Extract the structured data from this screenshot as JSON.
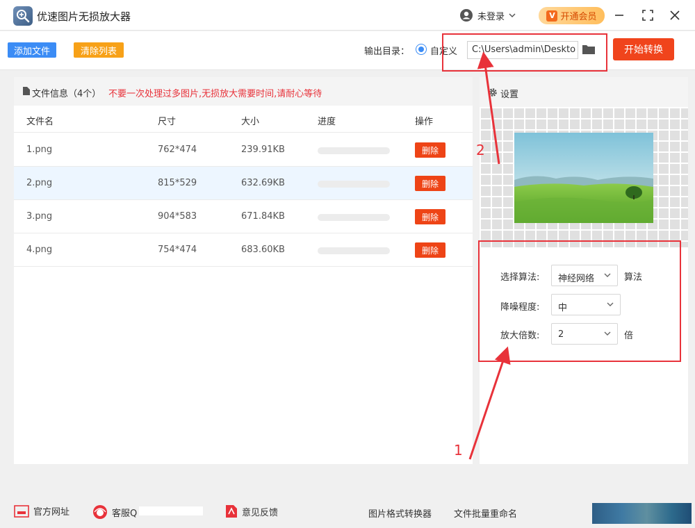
{
  "app": {
    "title": "优速图片无损放大器"
  },
  "header": {
    "login_label": "未登录",
    "vip_label": "开通会员",
    "vip_badge": "V"
  },
  "toolbar": {
    "add_label": "添加文件",
    "clear_label": "清除列表",
    "output_label": "输出目录：",
    "custom_label": "自定义",
    "output_path": "C:\\Users\\admin\\Deskto",
    "start_label": "开始转换"
  },
  "file_info": {
    "title": "文件信息（4个）",
    "warning": "不要一次处理过多图片,无损放大需要时间,请耐心等待"
  },
  "table": {
    "headers": [
      "文件名",
      "尺寸",
      "大小",
      "进度",
      "操作"
    ],
    "delete_label": "删除",
    "rows": [
      {
        "name": "1.png",
        "size": "762*474",
        "bytes": "239.91KB",
        "progress": 0
      },
      {
        "name": "2.png",
        "size": "815*529",
        "bytes": "632.69KB",
        "progress": 0
      },
      {
        "name": "3.png",
        "size": "904*583",
        "bytes": "671.84KB",
        "progress": 0
      },
      {
        "name": "4.png",
        "size": "754*474",
        "bytes": "683.60KB",
        "progress": 0
      }
    ]
  },
  "settings": {
    "title": "设置",
    "algorithm_label": "选择算法:",
    "algorithm_value": "神经网络",
    "algorithm_unit": "算法",
    "denoise_label": "降噪程度:",
    "denoise_value": "中",
    "scale_label": "放大倍数:",
    "scale_value": "2",
    "scale_unit": "倍"
  },
  "annotations": {
    "num1": "1",
    "num2": "2",
    "color": "#e8323a"
  },
  "footer": {
    "website_label": "官方网址",
    "service_label": "客服Q",
    "feedback_label": "意见反馈",
    "converter_label": "图片格式转换器",
    "rename_label": "文件批量重命名"
  },
  "colors": {
    "blue": "#3b8cf5",
    "orange": "#f7a118",
    "red": "#f0441c"
  }
}
